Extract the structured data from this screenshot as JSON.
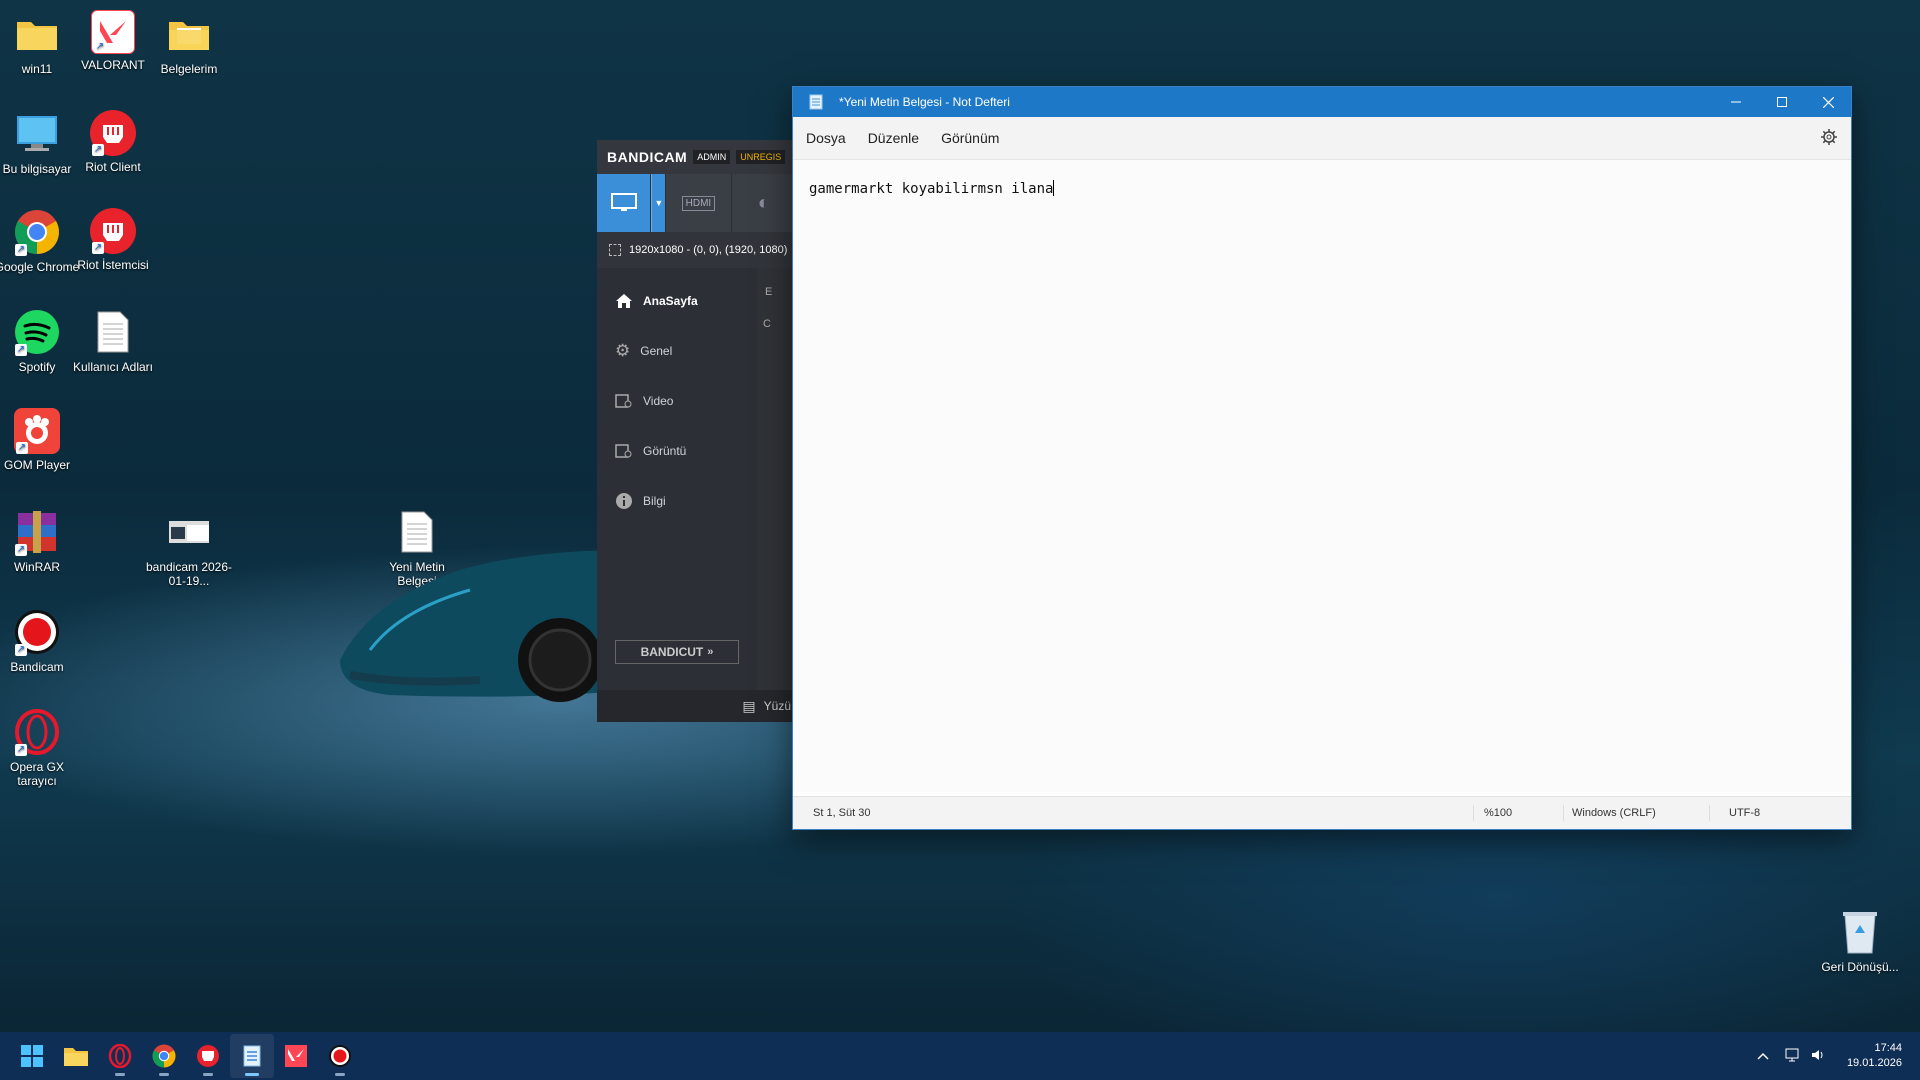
{
  "desktop": {
    "icons": [
      {
        "label": "win11"
      },
      {
        "label": "VALORANT"
      },
      {
        "label": "Belgelerim"
      },
      {
        "label": "Bu bilgisayar"
      },
      {
        "label": "Riot Client"
      },
      {
        "label": "Google Chrome"
      },
      {
        "label": "Riot İstemcisi"
      },
      {
        "label": "Spotify"
      },
      {
        "label": "Kullanıcı Adları"
      },
      {
        "label": "GOM Player"
      },
      {
        "label": "WinRAR"
      },
      {
        "label": "bandicam 2026-01-19..."
      },
      {
        "label": "Yeni Metin Belgesi"
      },
      {
        "label": "Bandicam"
      },
      {
        "label": "Opera GX tarayıcı"
      },
      {
        "label": "Geri Dönüşü..."
      }
    ]
  },
  "bandicam": {
    "logo": "BANDICAM",
    "badge_admin": "ADMIN",
    "badge_unreg": "UNREGIS",
    "mode_hdmi": "HDMI",
    "area_text": "1920x1080 - (0, 0), (1920, 1080)",
    "nav": [
      {
        "label": "AnaSayfa",
        "icon": "home-icon"
      },
      {
        "label": "Genel",
        "icon": "gear-icon"
      },
      {
        "label": "Video",
        "icon": "video-icon"
      },
      {
        "label": "Görüntü",
        "icon": "image-icon"
      },
      {
        "label": "Bilgi",
        "icon": "info-icon"
      }
    ],
    "bandicut_label": "BANDICUT",
    "footer_text": "Yüzü",
    "right_letters": [
      "E",
      "C"
    ]
  },
  "notepad": {
    "title": "*Yeni Metin Belgesi - Not Defteri",
    "menu": [
      "Dosya",
      "Düzenle",
      "Görünüm"
    ],
    "content": "gamermarkt koyabilirmsn ilana",
    "status": {
      "position": "St 1, Süt 30",
      "zoom": "%100",
      "line_ending": "Windows (CRLF)",
      "encoding": "UTF-8"
    }
  },
  "taskbar": {
    "clock_time": "17:44",
    "clock_date": "19.01.2026"
  },
  "colors": {
    "notepad_titlebar": "#1e78c8",
    "taskbar": "#0f2e55",
    "bandicam_accent": "#3a8fd8"
  }
}
